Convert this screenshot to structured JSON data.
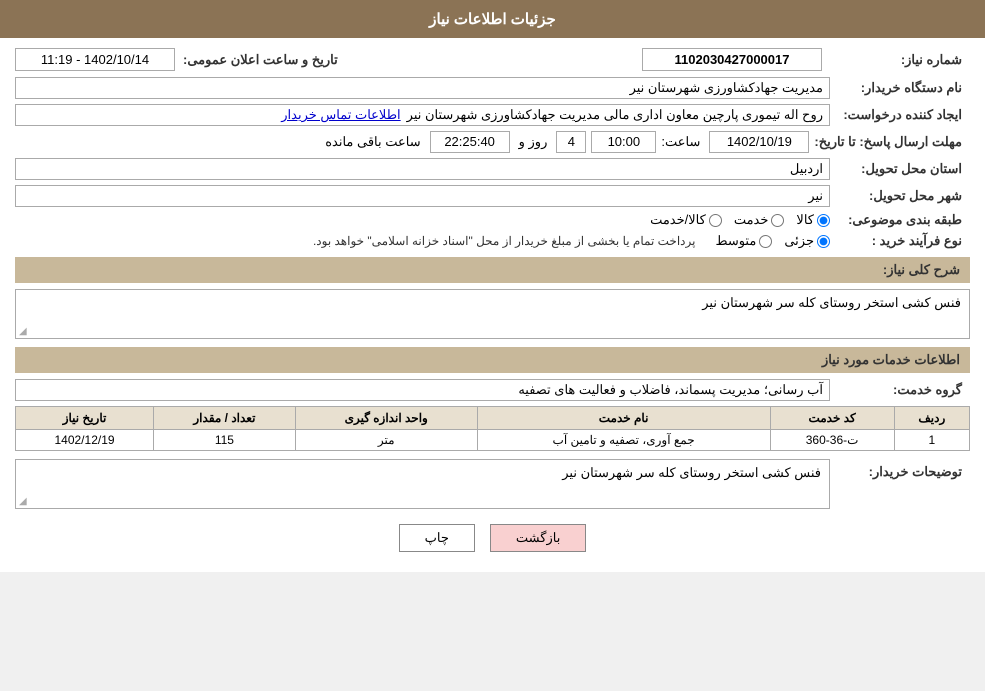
{
  "header": {
    "title": "جزئیات اطلاعات نیاز"
  },
  "fields": {
    "need_number_label": "شماره نیاز:",
    "need_number_value": "1102030427000017",
    "announce_date_label": "تاریخ و ساعت اعلان عمومی:",
    "announce_date_value": "1402/10/14 - 11:19",
    "buyer_name_label": "نام دستگاه خریدار:",
    "buyer_name_value": "مدیریت جهادکشاورزی شهرستان نیر",
    "requester_label": "ایجاد کننده درخواست:",
    "requester_value": "روح اله تیموری پارچین معاون اداری مالی مدیریت جهادکشاورزی شهرستان نیر",
    "contact_info_label": "اطلاعات تماس خریدار",
    "deadline_label": "مهلت ارسال پاسخ: تا تاریخ:",
    "deadline_date": "1402/10/19",
    "deadline_time_label": "ساعت:",
    "deadline_time": "10:00",
    "deadline_day_label": "روز و",
    "deadline_day": "4",
    "remaining_label": "ساعت باقی مانده",
    "remaining_value": "22:25:40",
    "delivery_province_label": "استان محل تحویل:",
    "delivery_province_value": "اردبیل",
    "delivery_city_label": "شهر محل تحویل:",
    "delivery_city_value": "نیر",
    "category_label": "طبقه بندی موضوعی:",
    "category_options": [
      "کالا",
      "خدمت",
      "کالا/خدمت"
    ],
    "category_selected": "کالا",
    "purchase_type_label": "نوع فرآیند خرید :",
    "purchase_type_note": "پرداخت تمام یا بخشی از مبلغ خریدار از محل \"اسناد خزانه اسلامی\" خواهد بود.",
    "purchase_options": [
      "جزئی",
      "متوسط"
    ],
    "purchase_selected": "جزئی",
    "description_section": "شرح کلی نیاز:",
    "description_value": "فنس کشی استخر روستای کله سر شهرستان نیر",
    "service_section": "اطلاعات خدمات مورد نیاز",
    "service_group_label": "گروه خدمت:",
    "service_group_value": "آب رسانی؛ مدیریت پسماند، فاضلاب و فعالیت های تصفیه",
    "table": {
      "columns": [
        "ردیف",
        "کد خدمت",
        "نام خدمت",
        "واحد اندازه گیری",
        "تعداد / مقدار",
        "تاریخ نیاز"
      ],
      "rows": [
        {
          "row_num": "1",
          "service_code": "ت-36-360",
          "service_name": "جمع آوری، تصفیه و تامین آب",
          "unit": "متر",
          "quantity": "115",
          "date": "1402/12/19"
        }
      ]
    },
    "buyer_desc_label": "توضیحات خریدار:",
    "buyer_desc_value": "فنس کشی استخر روستای کله سر شهرستان نیر"
  },
  "buttons": {
    "print_label": "چاپ",
    "back_label": "بازگشت"
  }
}
